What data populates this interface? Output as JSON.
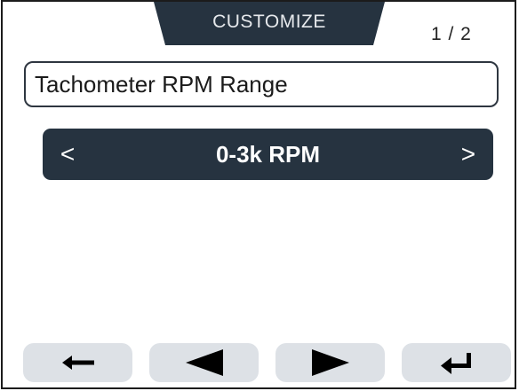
{
  "header": {
    "tab_label": "CUSTOMIZE",
    "page_indicator": "1 / 2"
  },
  "setting": {
    "title": "Tachometer RPM Range"
  },
  "selector": {
    "prev_label": "<",
    "value": "0-3k RPM",
    "next_label": ">"
  },
  "footer_buttons": [
    {
      "icon": "back-arrow-icon"
    },
    {
      "icon": "left-triangle-icon"
    },
    {
      "icon": "right-triangle-icon"
    },
    {
      "icon": "enter-return-icon"
    }
  ],
  "colors": {
    "accent": "#263340",
    "button_bg": "#dde1e6",
    "text": "#1b1b1b"
  }
}
